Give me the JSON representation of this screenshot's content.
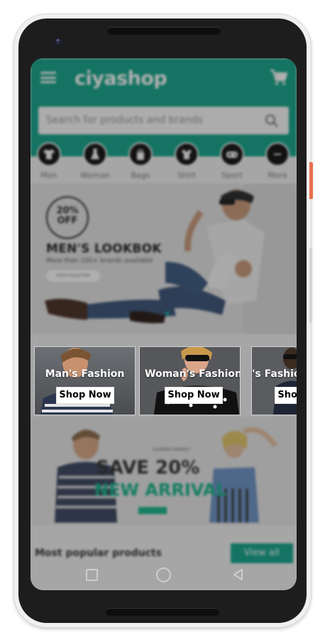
{
  "app": {
    "logo": "ciyashop",
    "search_placeholder": "Search for products and brands"
  },
  "categories": [
    {
      "label": "Men",
      "icon": "tshirt-icon"
    },
    {
      "label": "Woman",
      "icon": "dress-icon"
    },
    {
      "label": "Bags",
      "icon": "bag-icon"
    },
    {
      "label": "Shirt",
      "icon": "shirt-icon"
    },
    {
      "label": "Sport",
      "icon": "gamepad-icon"
    },
    {
      "label": "More",
      "icon": "more-icon"
    }
  ],
  "hero": {
    "badge_line1": "20%",
    "badge_line2": "OFF",
    "title": "MEN'S LOOKBOK",
    "subtitle": "More than 100+ brands available",
    "button": "SHOP COLLECTION"
  },
  "tiles": [
    {
      "title": "Man's Fashion",
      "button": "Shop Now"
    },
    {
      "title": "Woman's Fashion",
      "button": "Shop Now"
    },
    {
      "title": "Kid's Fashion",
      "button": "Shop Now"
    }
  ],
  "sale": {
    "small": "SUMMER MARKET",
    "line1": "SAVE 20%",
    "line2": "NEW ARRIVAL"
  },
  "popular": {
    "title": "Most popular products",
    "view_all": "View all"
  },
  "colors": {
    "brand": "#14a58a",
    "accent_side_button": "#e8714a"
  }
}
